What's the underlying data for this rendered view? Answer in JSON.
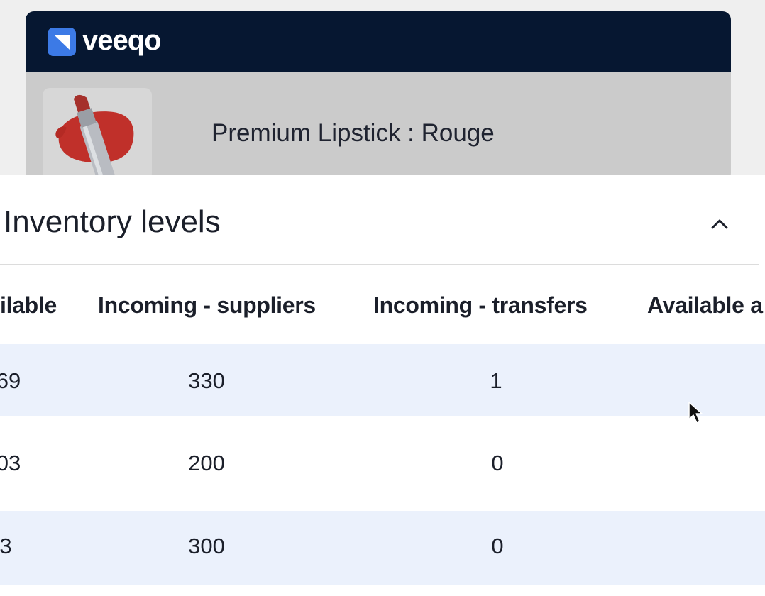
{
  "app": {
    "logo_text": "veeqo",
    "brand_color": "#3c7ae6",
    "topbar_color": "#061731"
  },
  "product": {
    "name": "Premium Lipstick : Rouge",
    "thumbnail": "lipstick-image"
  },
  "inventory": {
    "title": "Inventory levels",
    "collapse_icon": "chevron-up-icon",
    "columns": [
      "ilable",
      "Incoming - suppliers",
      "Incoming - transfers",
      "Available a"
    ],
    "rows": [
      {
        "available": "69",
        "incoming_suppliers": "330",
        "incoming_transfers": "1",
        "available_after": ""
      },
      {
        "available": "03",
        "incoming_suppliers": "200",
        "incoming_transfers": "0",
        "available_after": ""
      },
      {
        "available": "3",
        "incoming_suppliers": "300",
        "incoming_transfers": "0",
        "available_after": ""
      }
    ],
    "row_highlight_color": "#ebf1fc"
  }
}
